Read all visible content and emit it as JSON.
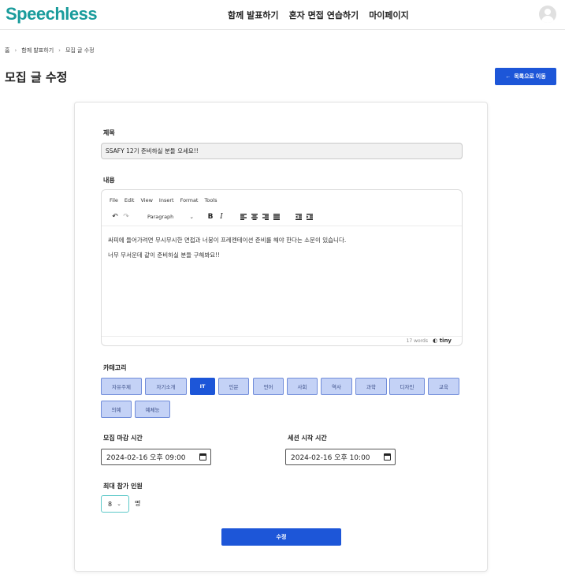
{
  "header": {
    "logo": "Speechless",
    "nav": [
      "함께 발표하기",
      "혼자 면접 연습하기",
      "마이페이지"
    ]
  },
  "breadcrumb": [
    "홈",
    "함께 발표하기",
    "모집 글 수정"
  ],
  "page": {
    "title": "모집 글 수정",
    "back_label": "목록으로 이동"
  },
  "form": {
    "title_label": "제목",
    "title_value": "SSAFY 12기 준비하실 분들 오세요!!",
    "content_label": "내용",
    "editor": {
      "menu": [
        "File",
        "Edit",
        "View",
        "Insert",
        "Format",
        "Tools"
      ],
      "format_value": "Paragraph",
      "paragraphs": [
        "싸피에 들어가려면 무시무시한 면접과 너붕이 프레젠테이션 준비를 해야 한다는 소문이 있습니다.",
        "너무 무서운데 같이 준비하실 분들 구해봐요!!"
      ],
      "word_count": "17 words",
      "brand": "tiny"
    },
    "category_label": "카테고리",
    "categories": [
      "자유주제",
      "자기소개",
      "IT",
      "인문",
      "언어",
      "사회",
      "역사",
      "과학",
      "디자인",
      "교육",
      "의예",
      "예체능"
    ],
    "selected_category": "IT",
    "deadline_label": "모집 마감 시간",
    "deadline_value": "2024-02-16 오후 09:00",
    "session_label": "세션 시작 시간",
    "session_value": "2024-02-16 오후 10:00",
    "max_label": "최대 참가 인원",
    "max_value": "8",
    "max_unit": "명",
    "submit_label": "수정"
  },
  "colors": {
    "brand": "#1a9c9c",
    "primary": "#1d56d8",
    "chip_bg": "#c4d2f6",
    "chip_border": "#6f8bd9"
  }
}
